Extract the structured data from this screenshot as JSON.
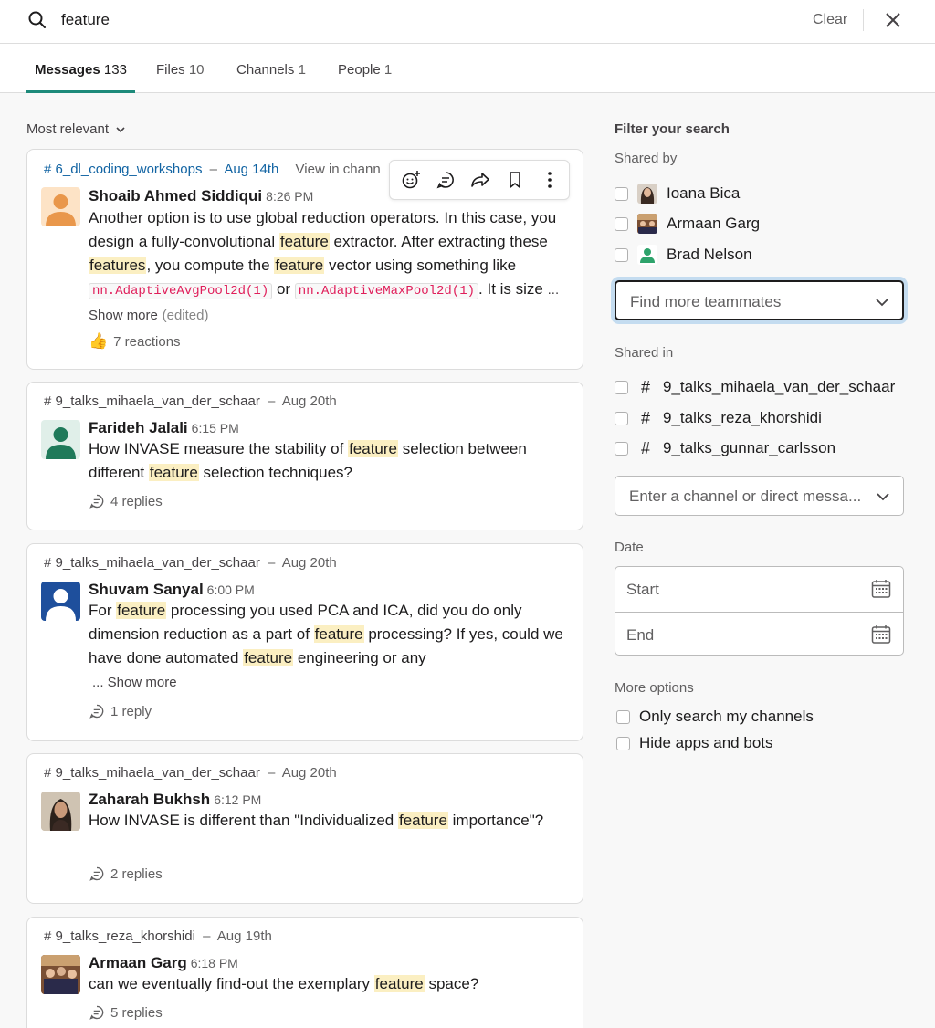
{
  "search": {
    "query": "feature",
    "clear_label": "Clear"
  },
  "tabs": [
    {
      "label": "Messages",
      "count": "133"
    },
    {
      "label": "Files",
      "count": "10"
    },
    {
      "label": "Channels",
      "count": "1"
    },
    {
      "label": "People",
      "count": "1"
    }
  ],
  "sort": {
    "label": "Most relevant"
  },
  "results": [
    {
      "channel": "# 6_dl_coding_workshops",
      "date": "Aug 14th",
      "view_in_channel": "View in chann",
      "author": "Shoaib Ahmed Siddiqui",
      "time": "8:26 PM",
      "text": {
        "p1": "Another option is to use global reduction operators. In this case, you design a fully-convolutional ",
        "h1": "feature",
        "p2": " extractor. After extracting these ",
        "h2": "features",
        "p3": ", you compute the ",
        "h3": "feature",
        "p4": " vector using something like ",
        "code1": "nn.AdaptiveAvgPool2d(1)",
        "p5": " or ",
        "code2": "nn.AdaptiveMaxPool2d(1)",
        "p6": ". It is size ",
        "show_more": "... Show more",
        "edited": "(edited)"
      },
      "reactions": "7 reactions"
    },
    {
      "channel": "# 9_talks_mihaela_van_der_schaar",
      "date": "Aug 20th",
      "author": "Farideh Jalali",
      "time": "6:15 PM",
      "text": {
        "p1": "How INVASE measure the stability of ",
        "h1": "feature",
        "p2": " selection between different ",
        "h2": "feature",
        "p3": " selection techniques?"
      },
      "replies": "4 replies"
    },
    {
      "channel": "# 9_talks_mihaela_van_der_schaar",
      "date": "Aug 20th",
      "author": "Shuvam Sanyal",
      "time": "6:00 PM",
      "text": {
        "p1": "For ",
        "h1": "feature",
        "p2": " processing you used PCA and ICA, did you do only dimension reduction as a part of ",
        "h2": "feature",
        "p3": " processing? If yes, could we have done automated ",
        "h3": "feature",
        "p4": " engineering or any",
        "show_more": "... Show more"
      },
      "replies": "1 reply"
    },
    {
      "channel": "# 9_talks_mihaela_van_der_schaar",
      "date": "Aug 20th",
      "author": "Zaharah Bukhsh",
      "time": "6:12 PM",
      "text": {
        "p1": "How INVASE is different than \"Individualized ",
        "h1": "feature",
        "p2": " importance\"?"
      },
      "replies": "2 replies"
    },
    {
      "channel": "# 9_talks_reza_khorshidi",
      "date": "Aug 19th",
      "author": "Armaan Garg",
      "time": "6:18 PM",
      "text": {
        "p1": "can we eventually find-out the exemplary ",
        "h1": "feature",
        "p2": " space?"
      },
      "replies": "5 replies"
    }
  ],
  "filters": {
    "title": "Filter your search",
    "shared_by_label": "Shared by",
    "people": [
      "Ioana Bica",
      "Armaan Garg",
      "Brad Nelson"
    ],
    "teammates_placeholder": "Find more teammates",
    "shared_in_label": "Shared in",
    "channels": [
      "9_talks_mihaela_van_der_schaar",
      "9_talks_reza_khorshidi",
      "9_talks_gunnar_carlsson"
    ],
    "channel_placeholder": "Enter a channel or direct messa...",
    "date_label": "Date",
    "date_start": "Start",
    "date_end": "End",
    "more_options_label": "More options",
    "options": [
      "Only search my channels",
      "Hide apps and bots"
    ]
  },
  "colors": {
    "highlight": "#fbefc2",
    "accent": "#1d8a7a",
    "link": "#1264a3",
    "code": "#e01e5a"
  }
}
